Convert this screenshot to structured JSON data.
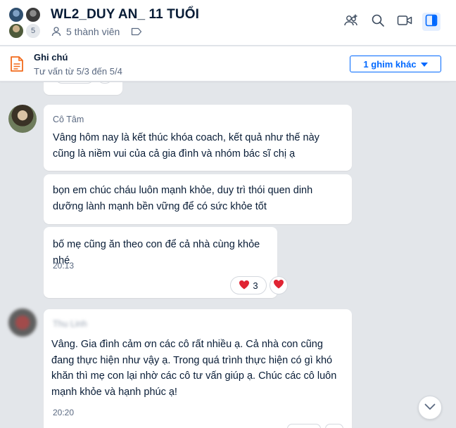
{
  "header": {
    "title": "WL2_DUY AN_ 11 TUỔI",
    "avatar_extra_count": "5",
    "members_label": "5 thành viên",
    "icons": [
      "add-member-icon",
      "search-icon",
      "video-call-icon",
      "sidebar-toggle-icon"
    ]
  },
  "pinned": {
    "title": "Ghi chú",
    "subtitle": "Tư vấn từ 5/3 đến 5/4",
    "more_label": "1 ghim khác"
  },
  "messages": [
    {
      "sender": "Cô Tâm",
      "texts": [
        "Vâng hôm nay là kết thúc khóa coach, kết quả như thế này cũng là niềm vui của cả gia đình và nhóm bác sĩ chị ạ",
        "bọn em chúc cháu luôn mạnh khỏe, duy trì thói quen dinh dưỡng lành mạnh bền vững để có sức khỏe tốt",
        "bố mẹ cũng ăn theo con để cả nhà cùng khỏe nhé"
      ],
      "time": "20:13",
      "reaction_count": "3"
    },
    {
      "sender": "Thu Linh",
      "text": "Vâng. Gia đình cảm ơn các cô rất nhiều ạ. Cả nhà con cũng đang thực hiện như vậy ạ. Trong quá trình thực hiện có gì khó khăn thì mẹ con lại nhờ các cô tư vấn giúp ạ.  Chúc các cô luôn mạnh khỏe và hạnh phúc ạ!",
      "time": "20:20"
    }
  ],
  "colors": {
    "accent": "#0068ff",
    "note_icon": "#f26b1d",
    "heart": "#e02433",
    "chat_bg": "#e3e6ea"
  }
}
